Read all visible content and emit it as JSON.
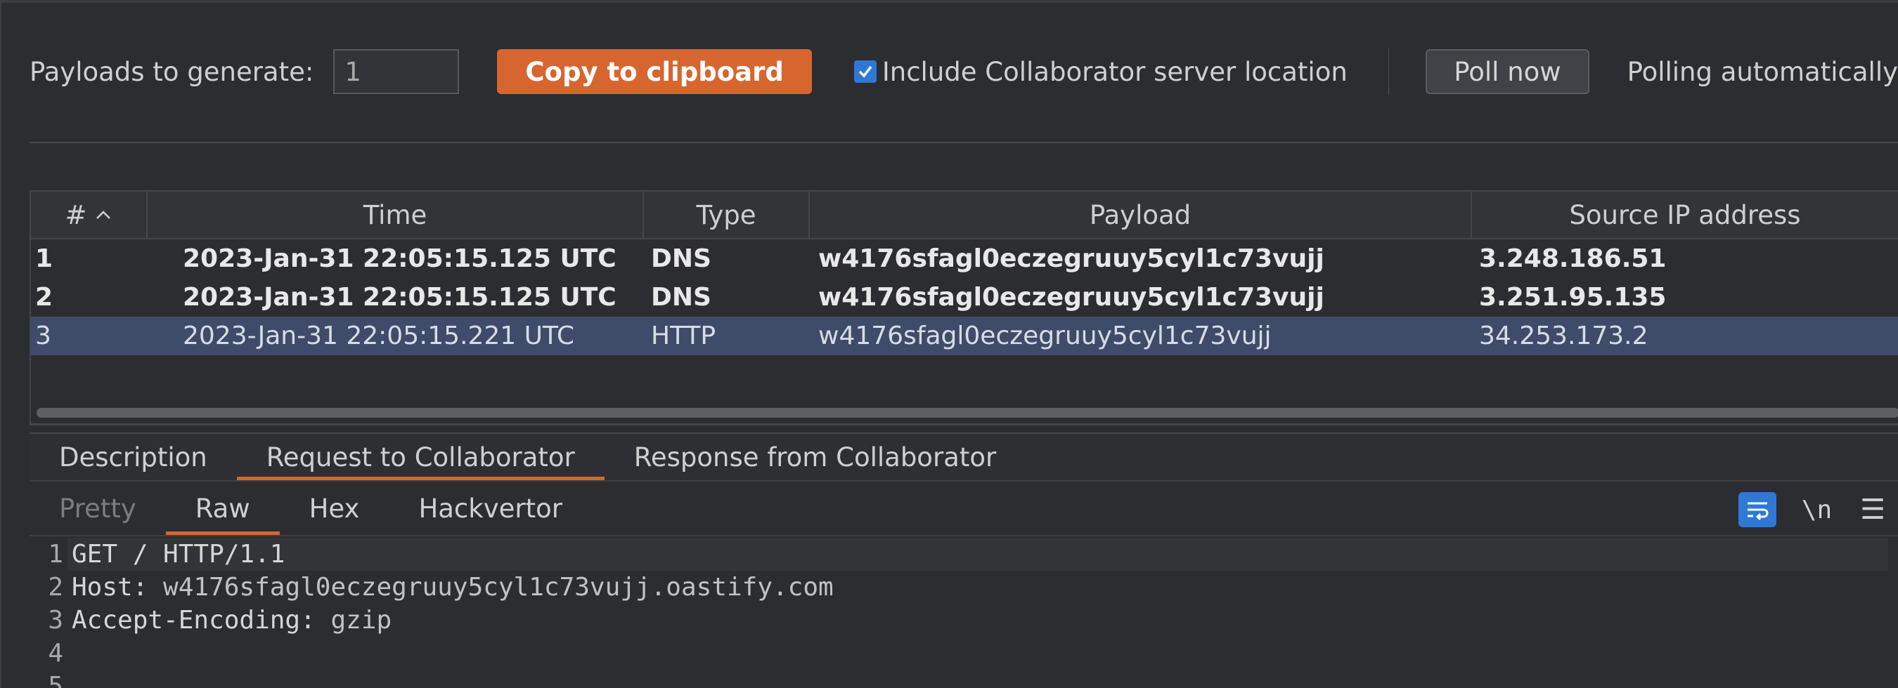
{
  "toolbar": {
    "payloads_label": "Payloads to generate:",
    "payloads_value": "1",
    "copy_label": "Copy to clipboard",
    "include_label": "Include Collaborator server location",
    "include_checked": true,
    "poll_label": "Poll now",
    "poll_status": "Polling automatically"
  },
  "table": {
    "columns": [
      "#",
      "Time",
      "Type",
      "Payload",
      "Source IP address"
    ],
    "sort_column": "#",
    "sort_direction": "ascending",
    "rows": [
      {
        "num": "1",
        "time": "2023-Jan-31 22:05:15.125 UTC",
        "type": "DNS",
        "payload": "w4176sfagl0eczegruuy5cyl1c73vujj",
        "source_ip": "3.248.186.51"
      },
      {
        "num": "2",
        "time": "2023-Jan-31 22:05:15.125 UTC",
        "type": "DNS",
        "payload": "w4176sfagl0eczegruuy5cyl1c73vujj",
        "source_ip": "3.251.95.135"
      },
      {
        "num": "3",
        "time": "2023-Jan-31 22:05:15.221 UTC",
        "type": "HTTP",
        "payload": "w4176sfagl0eczegruuy5cyl1c73vujj",
        "source_ip": "34.253.173.2"
      }
    ],
    "selected_row": 3
  },
  "detail_tabs": [
    "Description",
    "Request to Collaborator",
    "Response from Collaborator"
  ],
  "detail_active": "Request to Collaborator",
  "view_tabs": [
    "Pretty",
    "Raw",
    "Hex",
    "Hackvertor"
  ],
  "view_active": "Raw",
  "editor_tools": {
    "newline_label": "\\n",
    "menu_label": "☰"
  },
  "editor": {
    "lines": [
      {
        "n": "1",
        "key": "GET / HTTP/1.1",
        "value": ""
      },
      {
        "n": "2",
        "key": "Host: ",
        "value": "w4176sfagl0eczegruuy5cyl1c73vujj.oastify.com"
      },
      {
        "n": "3",
        "key": "Accept-Encoding: ",
        "value": "gzip"
      },
      {
        "n": "4",
        "key": "",
        "value": ""
      },
      {
        "n": "5",
        "key": "",
        "value": ""
      }
    ]
  },
  "colors": {
    "accent": "#d7652f",
    "checkbox": "#2f78d4",
    "selected_row": "#3e4c6a",
    "background": "#2b2d30"
  }
}
